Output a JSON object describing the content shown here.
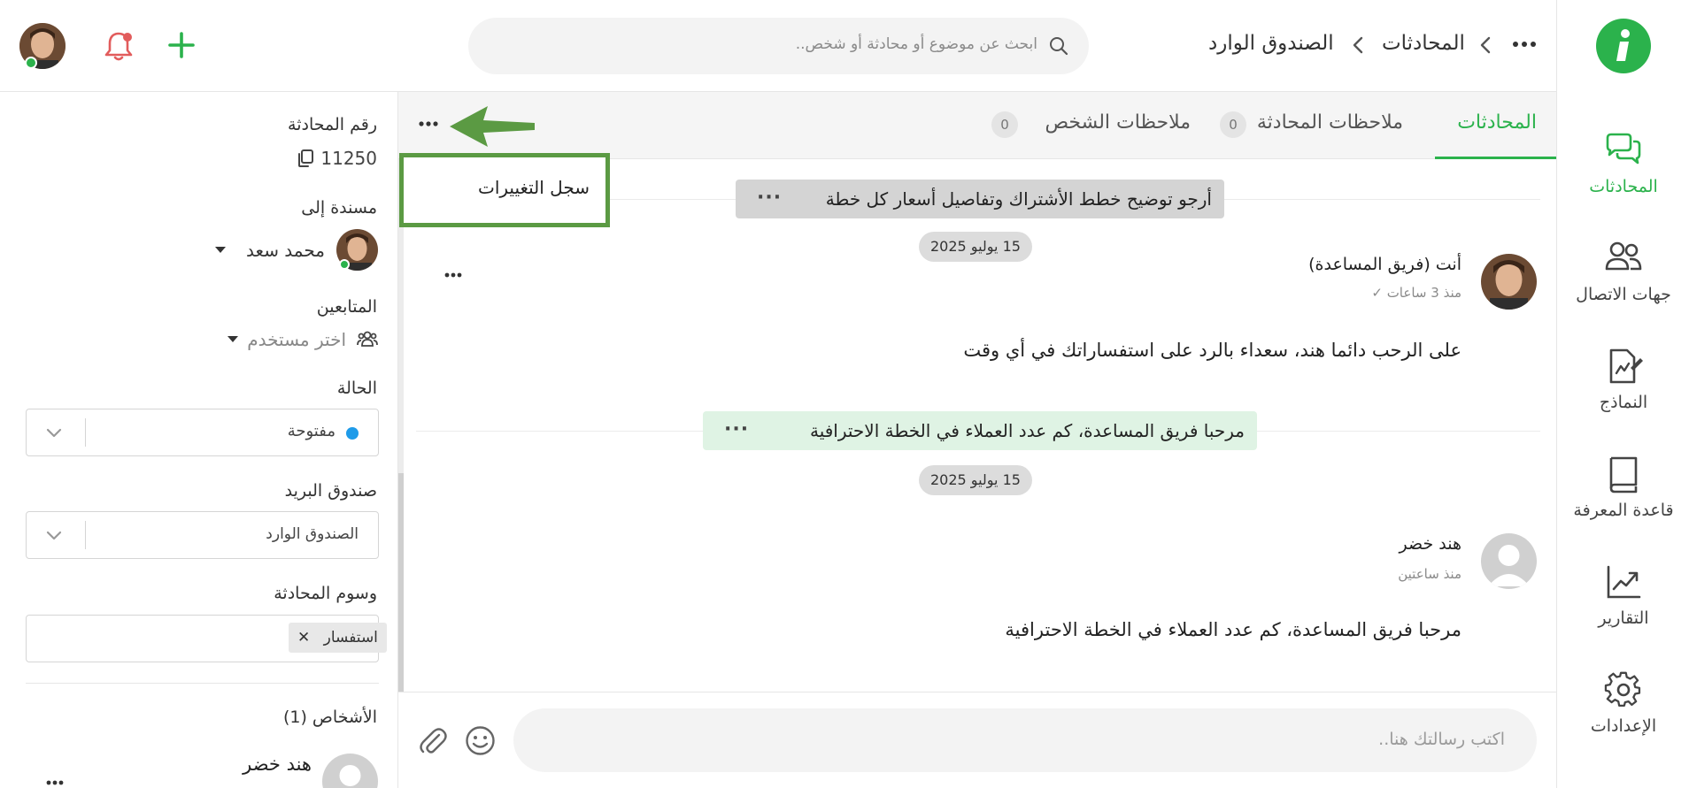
{
  "header": {
    "breadcrumb_inbox": "الصندوق الوارد",
    "breadcrumb_conversations": "المحادثات",
    "search_placeholder": "ابحث عن موضوع أو محادثة أو شخص.."
  },
  "nav": {
    "items": [
      {
        "label": "المحادثات",
        "icon": "chat-icon",
        "active": true
      },
      {
        "label": "جهات الاتصال",
        "icon": "contacts-icon"
      },
      {
        "label": "النماذج",
        "icon": "forms-icon"
      },
      {
        "label": "قاعدة المعرفة",
        "icon": "knowledge-base-icon"
      },
      {
        "label": "التقارير",
        "icon": "reports-icon"
      },
      {
        "label": "الإعدادات",
        "icon": "settings-icon"
      }
    ]
  },
  "tabs": {
    "conversations": "المحادثات",
    "conversation_notes": "ملاحظات المحادثة",
    "conversation_notes_count": "0",
    "person_notes": "ملاحظات الشخص",
    "person_notes_count": "0"
  },
  "dropdown": {
    "item": "سجل التغييرات"
  },
  "messages": {
    "subject_1": "أرجو توضيح خطط الأشتراك وتفاصيل أسعار كل خطة",
    "date_1": "15 يوليو 2025",
    "reply_author": "أنت (فريق المساعدة)",
    "reply_time": "منذ 3 ساعات",
    "reply_body": "على الرحب دائما هند، سعداء بالرد على استفساراتك في أي وقت",
    "subject_2": "مرحبا فريق المساعدة، كم عدد العملاء في الخطة الاحترافية",
    "date_2": "15 يوليو 2025",
    "customer_name": "هند خضر",
    "customer_time": "منذ ساعتين",
    "customer_body": "مرحبا فريق المساعدة، كم عدد العملاء في الخطة الاحترافية"
  },
  "composer": {
    "placeholder": "اكتب رسالتك هنا.."
  },
  "sidebar": {
    "conversation_number_label": "رقم المحادثة",
    "conversation_number": "11250",
    "assigned_label": "مسندة إلى",
    "assigned_name": "محمد سعد",
    "followers_label": "المتابعين",
    "followers_placeholder": "اختر مستخدم",
    "status_label": "الحالة",
    "status_value": "مفتوحة",
    "mailbox_label": "صندوق البريد",
    "mailbox_value": "الصندوق الوارد",
    "tags_label": "وسوم المحادثة",
    "tag_value": "استفسار",
    "people_label": "الأشخاص (1)",
    "person_name": "هند خضر"
  },
  "colors": {
    "brand_green": "#2bb24c",
    "status_open_blue": "#1e9be9",
    "arrow_green": "#5b9a43"
  }
}
